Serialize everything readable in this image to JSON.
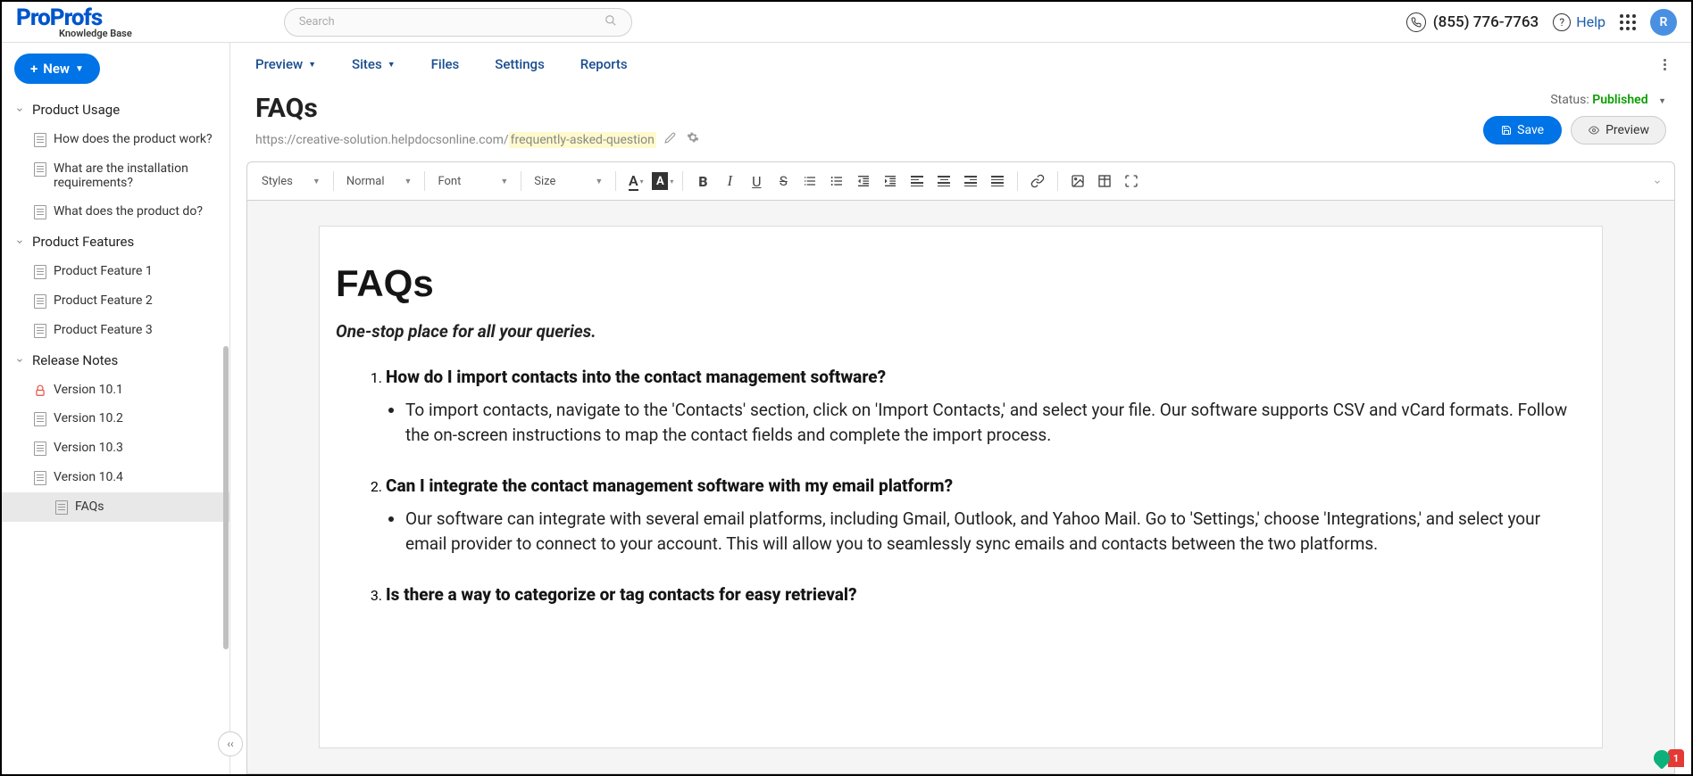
{
  "header": {
    "logo_main": "ProProfs",
    "logo_sub": "Knowledge Base",
    "search_placeholder": "Search",
    "phone": "(855) 776-7763",
    "help": "Help",
    "avatar_letter": "R"
  },
  "newBtn": "New",
  "sidebar": {
    "sections": [
      {
        "label": "Product Usage",
        "items": [
          {
            "label": "How does the product work?"
          },
          {
            "label": "What are the installation requirements?"
          },
          {
            "label": "What does the product do?"
          }
        ]
      },
      {
        "label": "Product Features",
        "items": [
          {
            "label": "Product Feature 1"
          },
          {
            "label": "Product Feature 2"
          },
          {
            "label": "Product Feature 3"
          }
        ]
      },
      {
        "label": "Release Notes",
        "items": [
          {
            "label": "Version 10.1",
            "locked": true
          },
          {
            "label": "Version 10.2"
          },
          {
            "label": "Version 10.3"
          },
          {
            "label": "Version 10.4"
          },
          {
            "label": "FAQs",
            "selected": true,
            "sub": true
          }
        ]
      }
    ]
  },
  "tabs": [
    "Preview",
    "Sites",
    "Files",
    "Settings",
    "Reports"
  ],
  "doc": {
    "title": "FAQs",
    "url_base": "https://creative-solution.helpdocsonline.com/",
    "url_slug": "frequently-asked-question",
    "status_label": "Status:",
    "status_value": "Published",
    "save": "Save",
    "preview": "Preview"
  },
  "toolbar": {
    "styles": "Styles",
    "format": "Normal",
    "font": "Font",
    "size": "Size"
  },
  "editor": {
    "h1": "FAQs",
    "sub": "One-stop place for all your queries.",
    "faqs": [
      {
        "q": "How do I import contacts into the contact management software?",
        "a": "To import contacts, navigate to the 'Contacts' section, click on 'Import Contacts,' and select your file. Our software supports CSV and vCard formats. Follow the on-screen instructions to map the contact fields and complete the import process."
      },
      {
        "q": "Can I integrate the contact management software with my email platform?",
        "a": "Our software can integrate with several email platforms, including Gmail, Outlook, and Yahoo Mail. Go to 'Settings,' choose 'Integrations,' and select your email provider to connect to your account. This will allow you to seamlessly sync emails and contacts between the two platforms."
      },
      {
        "q": "Is there a way to categorize or tag contacts for easy retrieval?",
        "a": ""
      }
    ]
  },
  "notif_count": "1"
}
